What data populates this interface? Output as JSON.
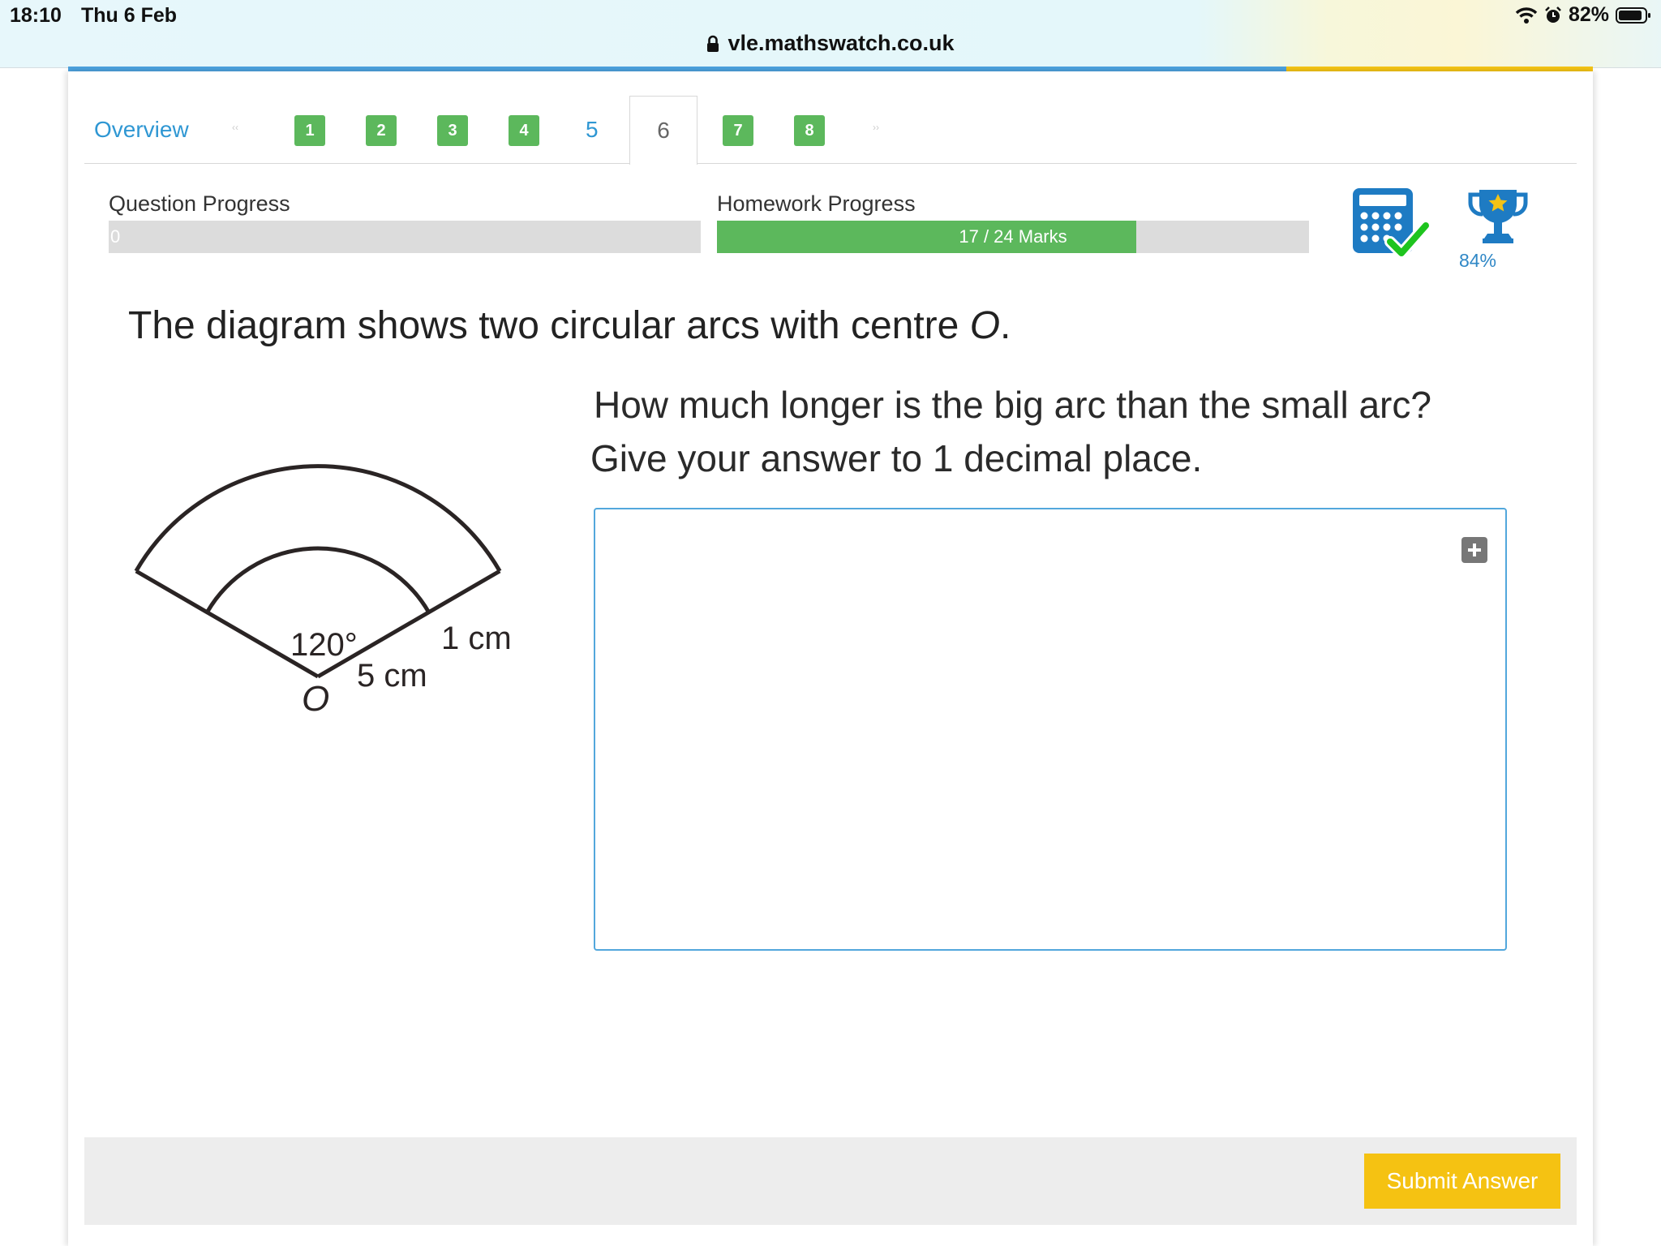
{
  "status_bar": {
    "time": "18:10",
    "date": "Thu 6 Feb",
    "battery": "82%"
  },
  "browser": {
    "url": "vle.mathswatch.co.uk"
  },
  "tabs": {
    "overview": "Overview",
    "questions": [
      {
        "label": "1",
        "state": "answered"
      },
      {
        "label": "2",
        "state": "answered"
      },
      {
        "label": "3",
        "state": "answered"
      },
      {
        "label": "4",
        "state": "answered"
      },
      {
        "label": "5",
        "state": "unanswered"
      },
      {
        "label": "6",
        "state": "current"
      },
      {
        "label": "7",
        "state": "answered"
      },
      {
        "label": "8",
        "state": "answered"
      }
    ]
  },
  "progress": {
    "question_label": "Question Progress",
    "question_value": "0",
    "question_fraction": 0,
    "homework_label": "Homework Progress",
    "homework_text": "17 / 24 Marks",
    "homework_fraction": 0.7083
  },
  "score": {
    "percent": "84%"
  },
  "question": {
    "intro": "The diagram shows two circular arcs with centre ",
    "intro_var": "O",
    "intro_end": ".",
    "line1": "How much longer is the big arc than the small arc?",
    "line2": "Give your answer to 1 decimal place."
  },
  "diagram": {
    "angle": "120°",
    "inner_radius": "5 cm",
    "gap": "1 cm",
    "centre": "O"
  },
  "footer": {
    "submit": "Submit Answer"
  },
  "colors": {
    "link": "#2f97d3",
    "green": "#5cb85c",
    "submit": "#f5c212",
    "answer_border": "#52a7dc"
  },
  "icons": [
    "wifi-icon",
    "alarm-icon",
    "battery-icon",
    "lock-icon",
    "calculator-check-icon",
    "trophy-icon",
    "plus-icon"
  ]
}
